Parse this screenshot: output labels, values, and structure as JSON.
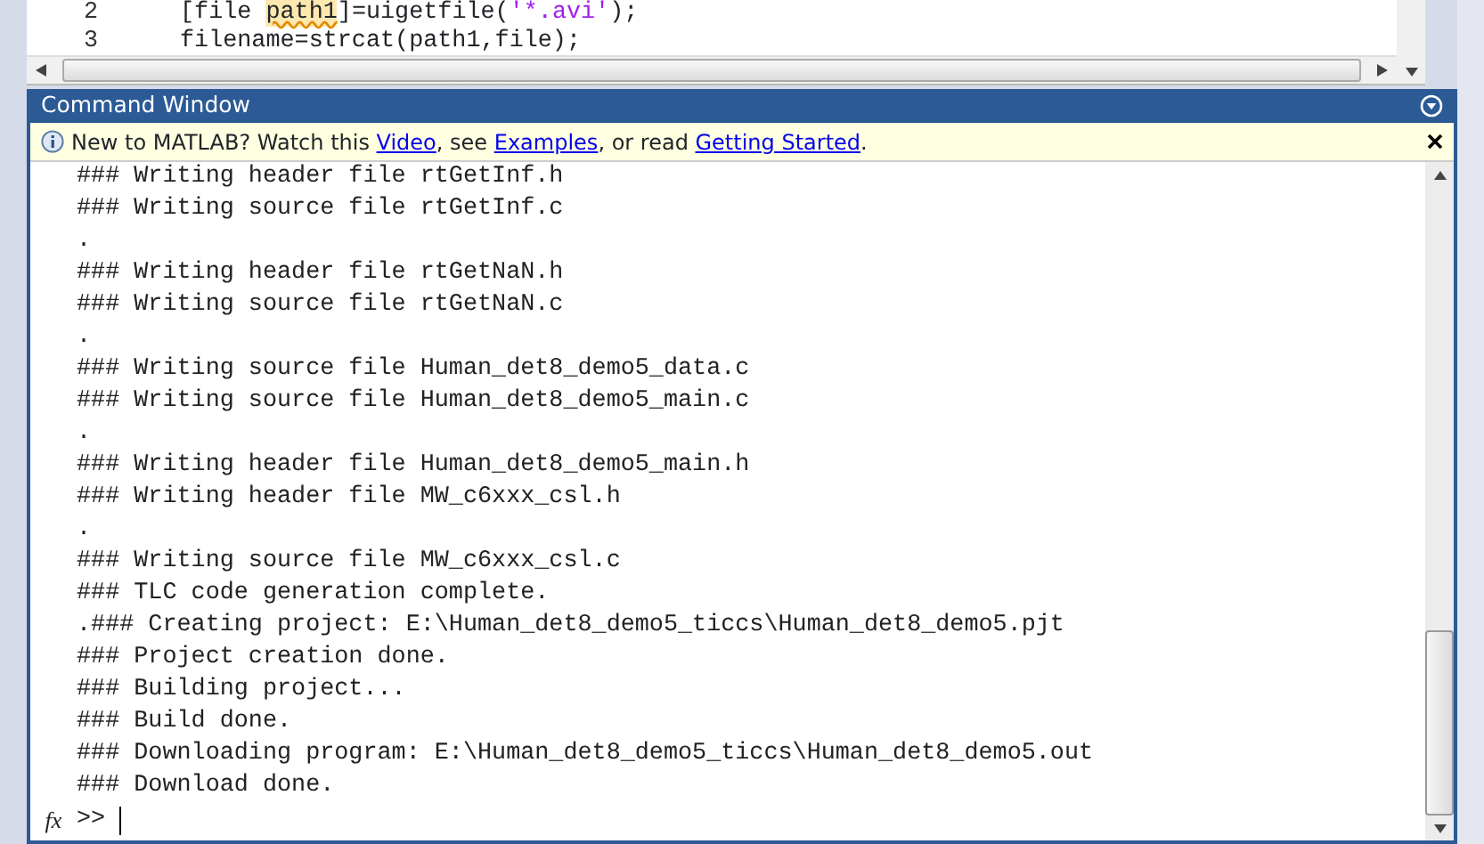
{
  "editor": {
    "lines": [
      {
        "number": "2",
        "tokens": [
          {
            "kind": "plain",
            "text": "[file "
          },
          {
            "kind": "flagged",
            "text": "path1"
          },
          {
            "kind": "plain",
            "text": "]=uigetfile("
          },
          {
            "kind": "string",
            "text": "'*.avi'"
          },
          {
            "kind": "plain",
            "text": ");"
          }
        ]
      },
      {
        "number": "3",
        "tokens": [
          {
            "kind": "plain",
            "text": "filename=strcat(path1,file);"
          }
        ]
      }
    ]
  },
  "command_window": {
    "title": "Command Window",
    "info_bar": {
      "segments": [
        {
          "kind": "text",
          "text": "New to MATLAB? Watch this "
        },
        {
          "kind": "link",
          "text": "Video"
        },
        {
          "kind": "text",
          "text": ", see "
        },
        {
          "kind": "link",
          "text": "Examples"
        },
        {
          "kind": "text",
          "text": ", or read "
        },
        {
          "kind": "link",
          "text": "Getting Started"
        },
        {
          "kind": "text",
          "text": "."
        }
      ]
    },
    "output": [
      "### Writing header file rtGetInf.h",
      "### Writing source file rtGetInf.c",
      ".",
      "### Writing header file rtGetNaN.h",
      "### Writing source file rtGetNaN.c",
      ".",
      "### Writing source file Human_det8_demo5_data.c",
      "### Writing source file Human_det8_demo5_main.c",
      ".",
      "### Writing header file Human_det8_demo5_main.h",
      "### Writing header file MW_c6xxx_csl.h",
      ".",
      "### Writing source file MW_c6xxx_csl.c",
      "### TLC code generation complete.",
      ".### Creating project: E:\\Human_det8_demo5_ticcs\\Human_det8_demo5.pjt",
      "### Project creation done.",
      "### Building project...",
      "### Build done.",
      "### Downloading program: E:\\Human_det8_demo5_ticcs\\Human_det8_demo5.out",
      "### Download done."
    ],
    "prompt": ">>",
    "function_button": "fx"
  }
}
